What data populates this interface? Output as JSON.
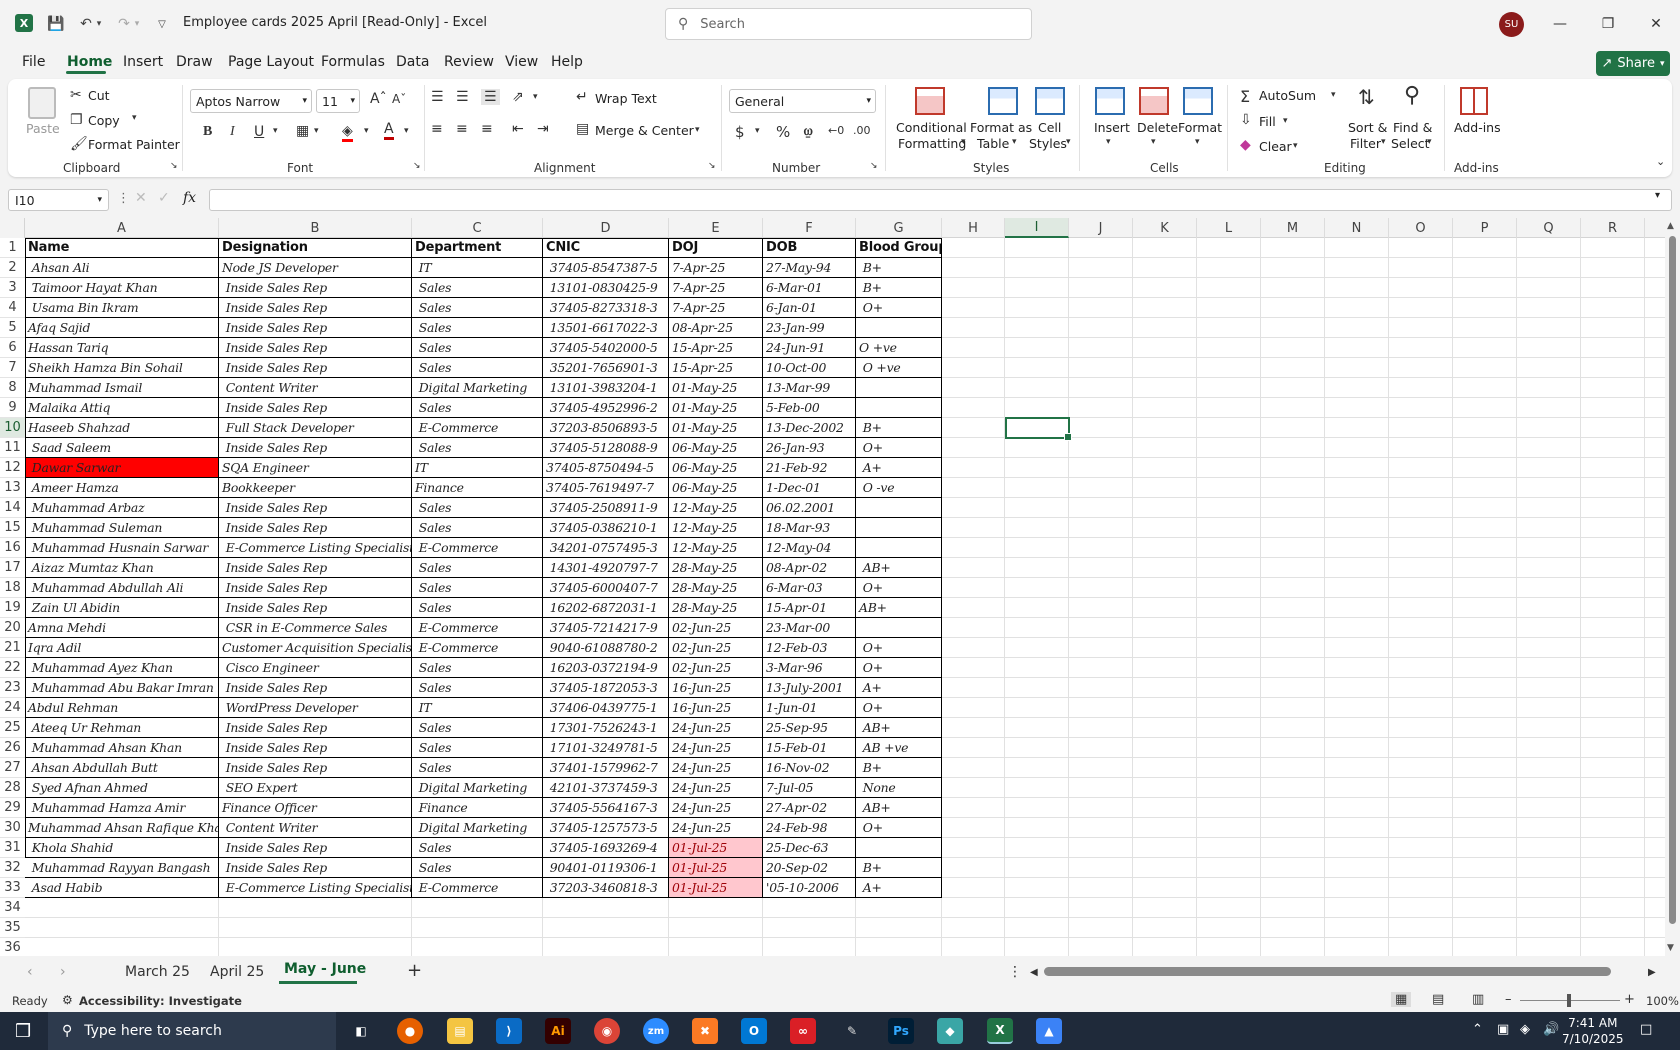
{
  "window": {
    "title": "Employee cards 2025 April  [Read-Only]  -  Excel",
    "search_placeholder": "Search",
    "user_initials": "SU"
  },
  "menu": [
    "File",
    "Home",
    "Insert",
    "Draw",
    "Page Layout",
    "Formulas",
    "Data",
    "Review",
    "View",
    "Help"
  ],
  "share_label": "Share",
  "ribbon": {
    "clipboard": {
      "label": "Clipboard",
      "paste": "Paste",
      "cut": "Cut",
      "copy": "Copy",
      "format_painter": "Format Painter"
    },
    "font": {
      "label": "Font",
      "font_name": "Aptos Narrow",
      "font_size": "11",
      "bold": "B",
      "italic": "I",
      "underline": "U"
    },
    "alignment": {
      "label": "Alignment",
      "wrap_text": "Wrap Text",
      "merge_center": "Merge & Center"
    },
    "number": {
      "label": "Number",
      "format": "General"
    },
    "styles": {
      "label": "Styles",
      "conditional": "Conditional",
      "conditional2": "Formatting",
      "format_as": "Format as",
      "format_as2": "Table",
      "cell_styles": "Cell",
      "cell_styles2": "Styles"
    },
    "cells": {
      "label": "Cells",
      "insert": "Insert",
      "delete": "Delete",
      "format": "Format"
    },
    "editing": {
      "label": "Editing",
      "autosum": "AutoSum",
      "fill": "Fill",
      "clear": "Clear",
      "sort": "Sort &",
      "sort2": "Filter",
      "find": "Find &",
      "find2": "Select"
    },
    "addins": {
      "label": "Add-ins",
      "addins": "Add-ins"
    }
  },
  "name_box": "I10",
  "fx": "fx",
  "columns": [
    "A",
    "B",
    "C",
    "D",
    "E",
    "F",
    "G",
    "H",
    "I",
    "J",
    "K",
    "L",
    "M",
    "N",
    "O",
    "P",
    "Q",
    "R"
  ],
  "headers": [
    "Name",
    "Designation",
    "Department",
    "CNIC",
    "DOJ",
    "DOB",
    "Blood Group"
  ],
  "rows": [
    [
      " Ahsan Ali",
      "Node JS Developer",
      " IT",
      " 37405-8547387-5",
      "7-Apr-25",
      "27-May-94",
      " B+"
    ],
    [
      " Taimoor Hayat Khan",
      " Inside Sales Rep",
      " Sales",
      " 13101-0830425-9",
      "7-Apr-25",
      "6-Mar-01",
      " B+"
    ],
    [
      " Usama Bin Ikram",
      " Inside Sales Rep",
      " Sales",
      " 37405-8273318-3",
      "7-Apr-25",
      "6-Jan-01",
      " O+"
    ],
    [
      "Afaq Sajid",
      " Inside Sales Rep",
      " Sales",
      " 13501-6617022-3",
      "08-Apr-25",
      "23-Jan-99",
      ""
    ],
    [
      "Hassan Tariq",
      " Inside Sales Rep",
      " Sales",
      " 37405-5402000-5",
      "15-Apr-25",
      "24-Jun-91",
      "O +ve"
    ],
    [
      "Sheikh Hamza Bin Sohail",
      " Inside Sales Rep",
      " Sales",
      " 35201-7656901-3",
      "15-Apr-25",
      "10-Oct-00",
      " O +ve"
    ],
    [
      "Muhammad Ismail",
      " Content Writer",
      " Digital Marketing",
      " 13101-3983204-1",
      "01-May-25",
      "13-Mar-99",
      ""
    ],
    [
      "Malaika Attiq",
      " Inside Sales Rep",
      " Sales",
      " 37405-4952996-2",
      "01-May-25",
      "5-Feb-00",
      ""
    ],
    [
      "Haseeb Shahzad",
      " Full Stack Developer",
      " E-Commerce",
      " 37203-8506893-5",
      "01-May-25",
      "13-Dec-2002",
      " B+"
    ],
    [
      " Saad Saleem",
      " Inside Sales Rep",
      " Sales",
      " 37405-5128088-9",
      "06-May-25",
      "26-Jan-93",
      " O+"
    ],
    [
      " Dawar Sarwar",
      "SQA Engineer",
      "IT",
      "37405-8750494-5",
      "06-May-25",
      "21-Feb-92",
      " A+"
    ],
    [
      " Ameer Hamza",
      "Bookkeeper",
      "Finance",
      "37405-7619497-7",
      "06-May-25",
      "1-Dec-01",
      " O -ve"
    ],
    [
      " Muhammad Arbaz",
      " Inside Sales Rep",
      " Sales",
      " 37405-2508911-9",
      "12-May-25",
      "06.02.2001",
      ""
    ],
    [
      " Muhammad Suleman",
      " Inside Sales Rep",
      " Sales",
      " 37405-0386210-1",
      "12-May-25",
      "18-Mar-93",
      ""
    ],
    [
      " Muhammad Husnain Sarwar",
      " E-Commerce Listing Specialist",
      " E-Commerce",
      " 34201-0757495-3",
      "12-May-25",
      "12-May-04",
      ""
    ],
    [
      " Aizaz Mumtaz Khan",
      " Inside Sales Rep",
      " Sales",
      " 14301-4920797-7",
      "28-May-25",
      "08-Apr-02",
      " AB+"
    ],
    [
      " Muhammad Abdullah Ali",
      " Inside Sales Rep",
      " Sales",
      " 37405-6000407-7",
      "28-May-25",
      "6-Mar-03",
      " O+"
    ],
    [
      " Zain Ul Abidin",
      " Inside Sales Rep",
      " Sales",
      " 16202-6872031-1",
      "28-May-25",
      "15-Apr-01",
      "AB+"
    ],
    [
      "Amna Mehdi",
      " CSR in E-Commerce Sales",
      " E-Commerce",
      " 37405-7214217-9",
      "02-Jun-25",
      "23-Mar-00",
      ""
    ],
    [
      "Iqra Adil",
      "Customer Acquisition Specialist",
      " E-Commerce",
      " 9040-61088780-2",
      "02-Jun-25",
      "12-Feb-03",
      " O+"
    ],
    [
      " Muhammad Ayez Khan",
      " Cisco Engineer",
      " Sales",
      " 16203-0372194-9",
      "02-Jun-25",
      "3-Mar-96",
      " O+"
    ],
    [
      " Muhammad Abu Bakar Imran",
      " Inside Sales Rep",
      " Sales",
      " 37405-1872053-3",
      "16-Jun-25",
      "13-July-2001",
      " A+"
    ],
    [
      "Abdul Rehman",
      " WordPress Developer",
      " IT",
      " 37406-0439775-1",
      "16-Jun-25",
      "1-Jun-01",
      " O+"
    ],
    [
      " Ateeq Ur Rehman",
      " Inside Sales Rep",
      " Sales",
      " 17301-7526243-1",
      "24-Jun-25",
      "25-Sep-95",
      " AB+"
    ],
    [
      " Muhammad Ahsan Khan",
      " Inside Sales Rep",
      " Sales",
      " 17101-3249781-5",
      "24-Jun-25",
      "15-Feb-01",
      " AB +ve"
    ],
    [
      " Ahsan Abdullah Butt",
      " Inside Sales Rep",
      " Sales",
      " 37401-1579962-7",
      "24-Jun-25",
      "16-Nov-02",
      " B+"
    ],
    [
      " Syed Afnan Ahmed",
      " SEO Expert",
      " Digital Marketing",
      " 42101-3737459-3",
      "24-Jun-25",
      "7-Jul-05",
      " None"
    ],
    [
      " Muhammad Hamza Amir",
      "Finance Officer",
      " Finance",
      " 37405-5564167-3",
      "24-Jun-25",
      "27-Apr-02",
      " AB+"
    ],
    [
      "Muhammad Ahsan Rafique Khan",
      " Content Writer",
      " Digital Marketing",
      " 37405-1257573-5",
      "24-Jun-25",
      "24-Feb-98",
      " O+"
    ],
    [
      " Khola Shahid",
      " Inside Sales Rep",
      " Sales",
      " 37405-1693269-4",
      "01-Jul-25",
      "25-Dec-63",
      ""
    ],
    [
      " Muhammad Rayyan Bangash",
      " Inside Sales Rep",
      " Sales",
      " 90401-0119306-1",
      "01-Jul-25",
      "20-Sep-02",
      " B+"
    ],
    [
      " Asad Habib",
      " E-Commerce Listing Specialist",
      " E-Commerce",
      " 37203-3460818-3",
      "01-Jul-25",
      "'05-10-2006",
      " A+"
    ]
  ],
  "row_numbers": [
    "1",
    "2",
    "3",
    "4",
    "5",
    "6",
    "7",
    "8",
    "9",
    "10",
    "11",
    "12",
    "13",
    "14",
    "15",
    "16",
    "17",
    "18",
    "19",
    "20",
    "21",
    "22",
    "23",
    "24",
    "25",
    "26",
    "27",
    "28",
    "29",
    "30",
    "31",
    "32",
    "33",
    "34",
    "35",
    "36"
  ],
  "sheets": [
    "March 25",
    "April 25",
    "May - June"
  ],
  "status": {
    "ready": "Ready",
    "accessibility": "Accessibility: Investigate",
    "zoom": "100%"
  },
  "taskbar": {
    "search_placeholder": "Type here to search",
    "time": "7:41 AM",
    "date": "7/10/2025"
  },
  "colors": {
    "accent": "#217346",
    "highlight_red": "#ff0000",
    "highlight_pink": "#ffc7ce"
  }
}
